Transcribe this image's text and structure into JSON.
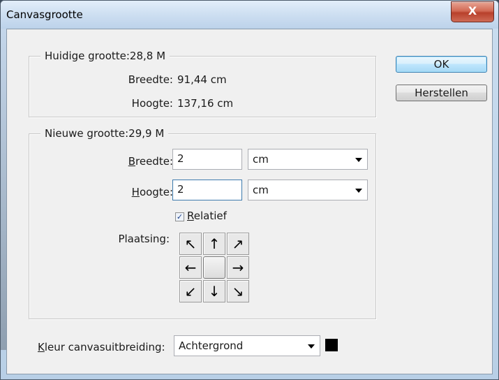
{
  "window": {
    "title": "Canvasgrootte",
    "close_glyph": "X"
  },
  "current_size": {
    "legend": "Huidige grootte:28,8 M",
    "width_label": "Breedte:",
    "width_value": "91,44 cm",
    "height_label": "Hoogte:",
    "height_value": "137,16 cm"
  },
  "new_size": {
    "legend": "Nieuwe grootte:29,9 M",
    "width_label_mnemonic": "B",
    "width_label_rest": "reedte:",
    "width_value": "2",
    "width_unit": "cm",
    "height_label_mnemonic": "H",
    "height_label_rest": "oogte:",
    "height_value": "2",
    "height_unit": "cm",
    "relative_mnemonic": "R",
    "relative_rest": "elatief",
    "relative_checked": true,
    "placement_label": "Plaatsing:",
    "anchor_selected": "center"
  },
  "buttons": {
    "ok": "OK",
    "reset": "Herstellen"
  },
  "extension": {
    "label_mnemonic": "K",
    "label_rest": "leur canvasuitbreiding:",
    "value": "Achtergrond",
    "swatch_color": "#000000"
  },
  "icons": {
    "nw": "arrow-up-left-icon",
    "n": "arrow-up-icon",
    "ne": "arrow-up-right-icon",
    "w": "arrow-left-icon",
    "e": "arrow-right-icon",
    "sw": "arrow-down-left-icon",
    "s": "arrow-down-icon",
    "se": "arrow-down-right-icon"
  }
}
